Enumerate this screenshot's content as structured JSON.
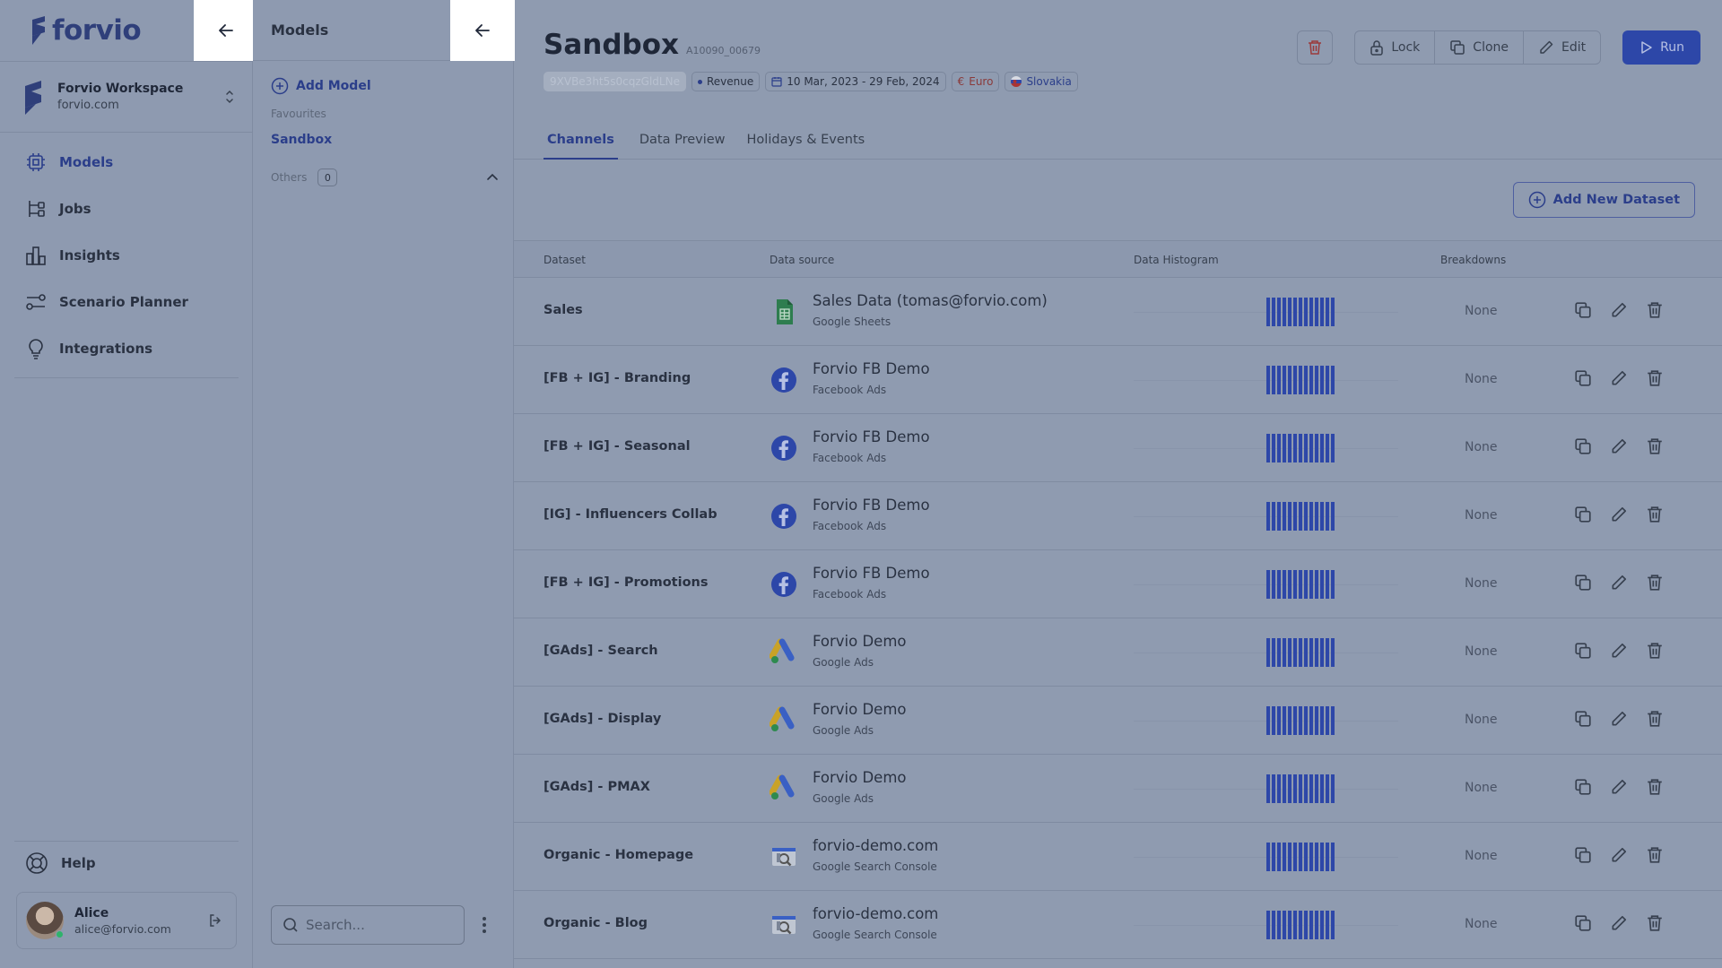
{
  "brand": {
    "name": "forvio"
  },
  "workspace": {
    "name": "Forvio Workspace",
    "domain": "forvio.com"
  },
  "nav": [
    {
      "label": "Models",
      "icon": "models-icon",
      "active": true
    },
    {
      "label": "Jobs",
      "icon": "jobs-icon",
      "active": false
    },
    {
      "label": "Insights",
      "icon": "insights-icon",
      "active": false
    },
    {
      "label": "Scenario Planner",
      "icon": "scenario-planner-icon",
      "active": false
    },
    {
      "label": "Integrations",
      "icon": "integrations-icon",
      "active": false
    }
  ],
  "help_label": "Help",
  "user": {
    "name": "Alice",
    "email": "alice@forvio.com"
  },
  "models_panel": {
    "title": "Models",
    "add_label": "Add Model",
    "favourites_label": "Favourites",
    "favourites": [
      "Sandbox"
    ],
    "others_label": "Others",
    "others_count": "0",
    "search_placeholder": "Search..."
  },
  "model": {
    "title": "Sandbox",
    "id": "A10090_00679",
    "tags": {
      "hash": "9XVBe3ht5s0cqzGldLNe",
      "metric": "Revenue",
      "date_range": "10 Mar, 2023 - 29 Feb, 2024",
      "currency": "Euro",
      "country": "Slovakia"
    }
  },
  "actions": {
    "lock": "Lock",
    "clone": "Clone",
    "edit": "Edit",
    "run": "Run"
  },
  "tabs": [
    {
      "label": "Channels",
      "active": true
    },
    {
      "label": "Data Preview",
      "active": false
    },
    {
      "label": "Holidays & Events",
      "active": false
    }
  ],
  "add_dataset_label": "Add New Dataset",
  "table": {
    "headers": {
      "dataset": "Dataset",
      "source": "Data source",
      "histogram": "Data Histogram",
      "breakdowns": "Breakdowns"
    },
    "rows": [
      {
        "dataset": "Sales",
        "source": "Sales Data (tomas@forvio.com)",
        "type": "Google Sheets",
        "icon": "google-sheets-icon",
        "breakdowns": "None"
      },
      {
        "dataset": "[FB + IG] - Branding",
        "source": "Forvio FB Demo",
        "type": "Facebook Ads",
        "icon": "facebook-icon",
        "breakdowns": "None"
      },
      {
        "dataset": "[FB + IG] - Seasonal",
        "source": "Forvio FB Demo",
        "type": "Facebook Ads",
        "icon": "facebook-icon",
        "breakdowns": "None"
      },
      {
        "dataset": "[IG] - Influencers Collab",
        "source": "Forvio FB Demo",
        "type": "Facebook Ads",
        "icon": "facebook-icon",
        "breakdowns": "None"
      },
      {
        "dataset": "[FB + IG] - Promotions",
        "source": "Forvio FB Demo",
        "type": "Facebook Ads",
        "icon": "facebook-icon",
        "breakdowns": "None"
      },
      {
        "dataset": "[GAds] - Search",
        "source": "Forvio Demo",
        "type": "Google Ads",
        "icon": "google-ads-icon",
        "breakdowns": "None"
      },
      {
        "dataset": "[GAds] - Display",
        "source": "Forvio Demo",
        "type": "Google Ads",
        "icon": "google-ads-icon",
        "breakdowns": "None"
      },
      {
        "dataset": "[GAds] - PMAX",
        "source": "Forvio Demo",
        "type": "Google Ads",
        "icon": "google-ads-icon",
        "breakdowns": "None"
      },
      {
        "dataset": "Organic - Homepage",
        "source": "forvio-demo.com",
        "type": "Google Search Console",
        "icon": "google-search-console-icon",
        "breakdowns": "None"
      },
      {
        "dataset": "Organic - Blog",
        "source": "forvio-demo.com",
        "type": "Google Search Console",
        "icon": "google-search-console-icon",
        "breakdowns": "None"
      }
    ]
  },
  "colors": {
    "accent": "#2d47a8",
    "overlay_bg": "#8e9ab0"
  }
}
